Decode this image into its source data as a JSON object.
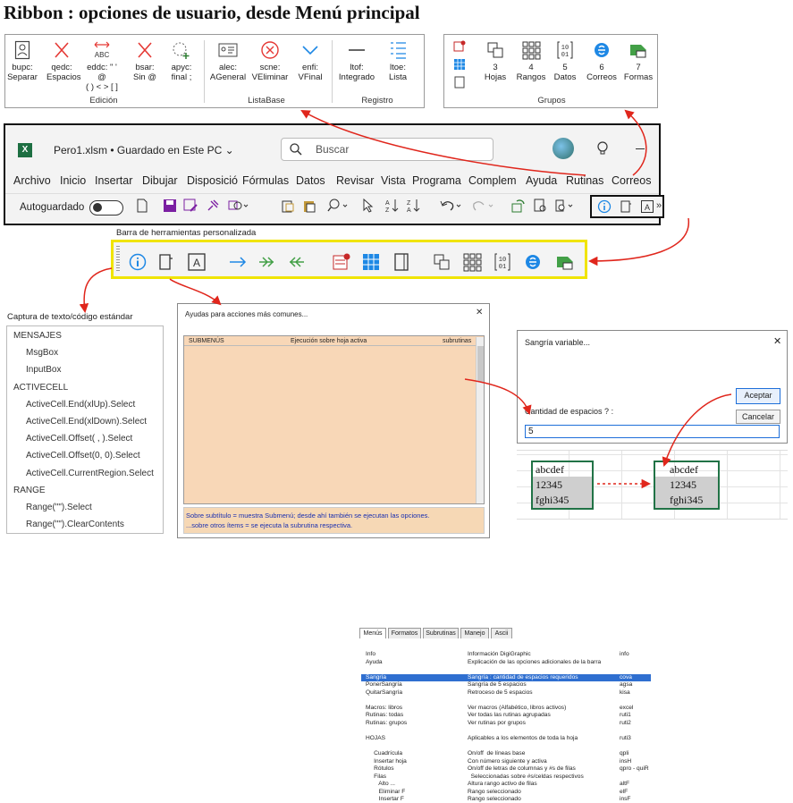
{
  "title": "Ribbon : opciones de usuario, desde Menú principal",
  "ribbon_left": {
    "buttons": [
      {
        "l1": "bupc:",
        "l2": "Separar"
      },
      {
        "l1": "qedc:",
        "l2": "Espacios"
      },
      {
        "l1": "eddc: \" ' @",
        "l2": "( ) < > [ ]"
      },
      {
        "l1": "bsar:",
        "l2": "Sin @"
      },
      {
        "l1": "apyc:",
        "l2": "final ;"
      },
      {
        "l1": "alec:",
        "l2": "AGeneral"
      },
      {
        "l1": "scne:",
        "l2": "VEliminar"
      },
      {
        "l1": "enfi:",
        "l2": "VFinal"
      },
      {
        "l1": "ltof:",
        "l2": "Integrado"
      },
      {
        "l1": "ltoe:",
        "l2": "Lista"
      }
    ],
    "abc_text": "ABC",
    "groups": [
      "Edición",
      "ListaBase",
      "Registro"
    ]
  },
  "ribbon_right": {
    "buttons": [
      {
        "l1": "3",
        "l2": "Hojas"
      },
      {
        "l1": "4",
        "l2": "Rangos"
      },
      {
        "l1": "5",
        "l2": "Datos"
      },
      {
        "l1": "6",
        "l2": "Correos"
      },
      {
        "l1": "7",
        "l2": "Formas"
      }
    ],
    "group": "Grupos"
  },
  "excel": {
    "filename": "Pero1.xlsm • Guardado en Este PC ⌄",
    "search_placeholder": "Buscar",
    "menu": [
      "Archivo",
      "Inicio",
      "Insertar",
      "Dibujar",
      "Disposició",
      "Fórmulas",
      "Datos",
      "Revisar",
      "Vista",
      "Programa",
      "Complem",
      "Ayuda",
      "Rutinas",
      "Correos"
    ],
    "autosave": "Autoguardado"
  },
  "toolbar_caption": "Barra de herramientas personalizada",
  "capture": {
    "caption": "Captura de texto/código estándar",
    "items": [
      {
        "text": "MENSAJES",
        "indent": 0
      },
      {
        "text": "MsgBox",
        "indent": 1
      },
      {
        "text": "InputBox",
        "indent": 1
      },
      {
        "text": "ACTIVECELL",
        "indent": 0
      },
      {
        "text": "ActiveCell.End(xlUp).Select",
        "indent": 1
      },
      {
        "text": "ActiveCell.End(xlDown).Select",
        "indent": 1
      },
      {
        "text": "ActiveCell.Offset( ,  ).Select",
        "indent": 1
      },
      {
        "text": "ActiveCell.Offset(0, 0).Select",
        "indent": 1
      },
      {
        "text": "ActiveCell.CurrentRegion.Select",
        "indent": 1
      },
      {
        "text": "RANGE",
        "indent": 0
      },
      {
        "text": "Range(\"\").Select",
        "indent": 1
      },
      {
        "text": "Range(\"\").ClearContents",
        "indent": 1
      }
    ]
  },
  "help": {
    "title": "Ayudas para acciones más comunes...",
    "close": "✕",
    "tabs": [
      "Menús",
      "Formatos",
      "Subrutinas",
      "Manejo",
      "Ascii"
    ],
    "headers": [
      "SUBMENÚS",
      "Ejecución sobre hoja activa",
      "subrutinas"
    ],
    "rows": [
      {
        "a": "Info",
        "b": "Información DigiGraphic",
        "c": "info"
      },
      {
        "a": "Ayuda",
        "b": "Explicación de las opciones adicionales de la barra",
        "c": ""
      },
      {
        "a": "",
        "b": "",
        "c": ""
      },
      {
        "a": "Sangría",
        "b": "Sangría : cantidad de espacios requeridos",
        "c": "cova",
        "sel": true
      },
      {
        "a": "PonerSangría",
        "b": "Sangría de 5 espacios",
        "c": "agsa"
      },
      {
        "a": "QuitarSangría",
        "b": "Retroceso de 5 espacios",
        "c": "kisa"
      },
      {
        "a": "",
        "b": "",
        "c": ""
      },
      {
        "a": "Macros: libros",
        "b": "Ver macros (Alfabético, libros activos)",
        "c": "excel"
      },
      {
        "a": "Rutinas: todas",
        "b": "Ver todas las rutinas agrupadas",
        "c": "ruti1"
      },
      {
        "a": "Rutinas: grupos",
        "b": "Ver rutinas por grupos",
        "c": "ruti2"
      },
      {
        "a": "",
        "b": "",
        "c": ""
      },
      {
        "a": "HOJAS",
        "b": "Aplicables a los elementos de toda la hoja",
        "c": "ruti3"
      },
      {
        "a": "",
        "b": "",
        "c": ""
      },
      {
        "a": "     Cuadrícula",
        "b": "On/off  de líneas base",
        "c": "qpli"
      },
      {
        "a": "     Insertar hoja",
        "b": "Con número siguiente y activa",
        "c": "insH"
      },
      {
        "a": "     Rótulos",
        "b": "On/off de letras de columnas y #s de filas",
        "c": "qpro - quiR"
      },
      {
        "a": "     Filas",
        "b": "  Seleccionadas sobre #s/celdas respectivos",
        "c": ""
      },
      {
        "a": "        Alto ...",
        "b": "Altura rango activo de filas",
        "c": "altF"
      },
      {
        "a": "        Eliminar F",
        "b": "Rango seleccionado",
        "c": "elF"
      },
      {
        "a": "        Insertar F",
        "b": "Rango seleccionado",
        "c": "insF"
      }
    ],
    "footer1": "Sobre subtítulo = muestra Submenú; desde ahí también se ejecutan las opciones.",
    "footer2": "...sobre otros ítems =  se ejecuta la subrutina respectiva."
  },
  "sangria": {
    "title": "Sangría variable...",
    "close": "✕",
    "accept": "Aceptar",
    "cancel": "Cancelar",
    "label": "Cantidad de espacios ? :",
    "value": "5"
  },
  "cells_before": [
    "abcdef",
    "12345",
    "fghi345"
  ],
  "cells_after": [
    "abcdef",
    "12345",
    "fghi345"
  ]
}
